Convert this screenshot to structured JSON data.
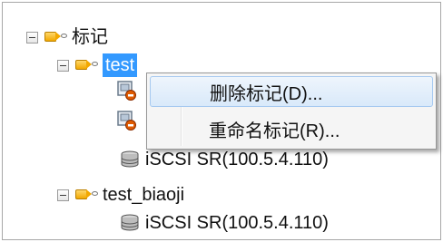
{
  "tree": {
    "root": {
      "label": "标记",
      "icon": "tag-icon",
      "expanded": true
    },
    "child1": {
      "label": "test",
      "icon": "tag-icon",
      "expanded": true,
      "selected": true,
      "items": [
        {
          "icon": "vm-icon"
        },
        {
          "icon": "vm-icon"
        },
        {
          "icon": "storage-icon",
          "label": "iSCSI SR(100.5.4.110)"
        }
      ]
    },
    "child2": {
      "label": "test_biaoji",
      "icon": "tag-icon",
      "expanded": true,
      "items": [
        {
          "icon": "storage-icon",
          "label": "iSCSI SR(100.5.4.110)"
        }
      ]
    }
  },
  "context_menu": {
    "items": [
      {
        "label": "删除标记(D)...",
        "hover": true
      },
      {
        "label": "重命名标记(R)..."
      }
    ]
  },
  "colors": {
    "selection": "#3399ff",
    "menu_hover_border": "#a6c9f0",
    "tag_fill": "#f2a800"
  }
}
